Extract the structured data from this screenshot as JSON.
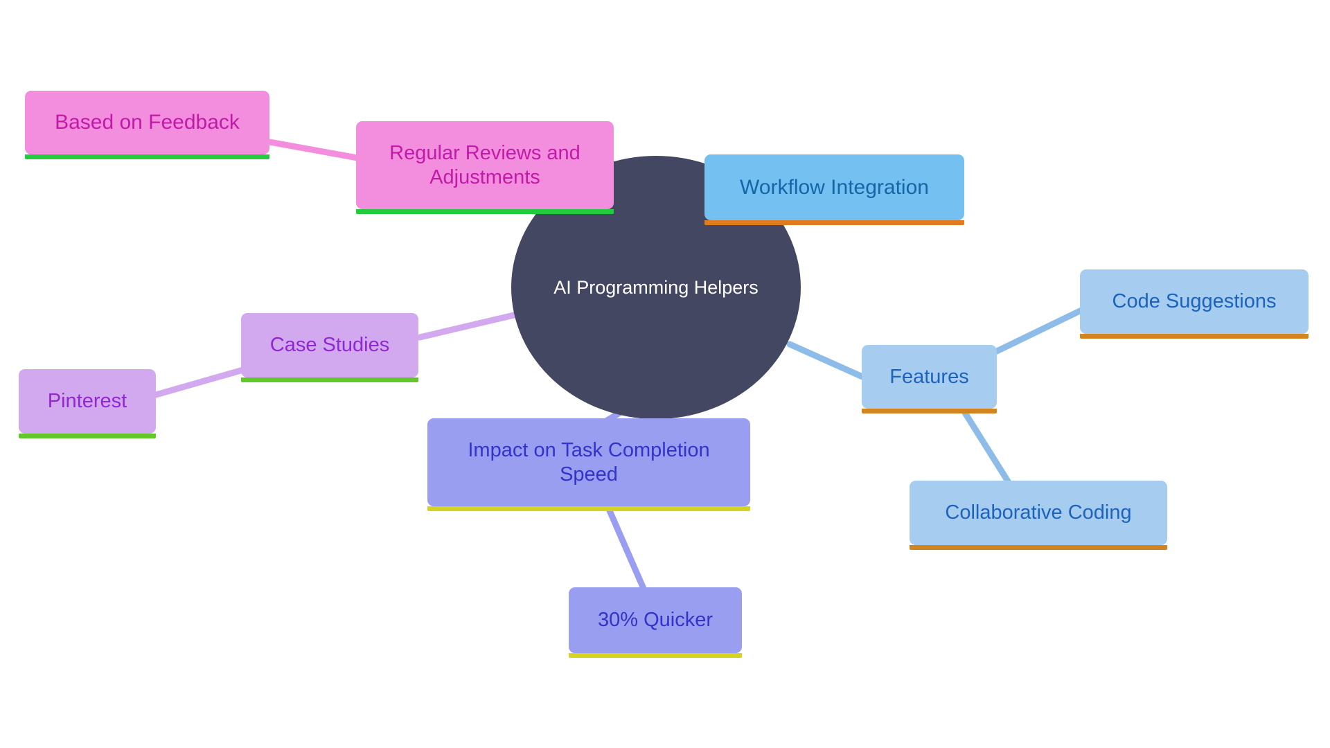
{
  "diagram": {
    "type": "mindmap",
    "title": "AI Programming Helpers",
    "background": "#ffffff"
  },
  "root": {
    "label": "AI Programming Helpers",
    "fill": "#434761",
    "text_color": "#ffffff",
    "shape": "ellipse"
  },
  "branches": [
    {
      "id": "workflow-integration",
      "label": "Workflow Integration",
      "fill": "#74c0f0",
      "text_color": "#1565a8",
      "accent": "#e07b20",
      "edge_color": "#74c0f0"
    },
    {
      "id": "features",
      "label": "Features",
      "fill": "#a6cdf0",
      "text_color": "#1d63bb",
      "accent": "#d4841f",
      "edge_color": "#8dbce8"
    },
    {
      "id": "code-suggestions",
      "label": "Code Suggestions",
      "fill": "#a6cdf0",
      "text_color": "#1d63bb",
      "accent": "#d4841f",
      "edge_color": "#8dbce8"
    },
    {
      "id": "collaborative-coding",
      "label": "Collaborative Coding",
      "fill": "#a6cdf0",
      "text_color": "#1d63bb",
      "accent": "#d4841f",
      "edge_color": "#8dbce8"
    },
    {
      "id": "impact-on-task-completion-speed",
      "label": "Impact on Task Completion\nSpeed",
      "fill": "#9a9ef0",
      "text_color": "#3333cc",
      "accent": "#d6d321",
      "edge_color": "#9a9ef0"
    },
    {
      "id": "thirty-percent-quicker",
      "label": "30% Quicker",
      "fill": "#9a9ef0",
      "text_color": "#3333cc",
      "accent": "#d6d321",
      "edge_color": "#9a9ef0"
    },
    {
      "id": "case-studies",
      "label": "Case Studies",
      "fill": "#d2a8ee",
      "text_color": "#9127d4",
      "accent": "#63c72b",
      "edge_color": "#d2a8ee"
    },
    {
      "id": "pinterest",
      "label": "Pinterest",
      "fill": "#d2a8ee",
      "text_color": "#9127d4",
      "accent": "#63c72b",
      "edge_color": "#d2a8ee"
    },
    {
      "id": "regular-reviews-and-adjustments",
      "label": "Regular Reviews and\nAdjustments",
      "fill": "#f38ede",
      "text_color": "#c21aa8",
      "accent": "#22cc3b",
      "edge_color": "#f38ede"
    },
    {
      "id": "based-on-feedback",
      "label": "Based on Feedback",
      "fill": "#f38ede",
      "text_color": "#c21aa8",
      "accent": "#22cc3b",
      "edge_color": "#f38ede"
    }
  ],
  "connections": [
    {
      "from": "AI Programming Helpers",
      "to": "Workflow Integration"
    },
    {
      "from": "AI Programming Helpers",
      "to": "Features"
    },
    {
      "from": "Features",
      "to": "Code Suggestions"
    },
    {
      "from": "Features",
      "to": "Collaborative Coding"
    },
    {
      "from": "AI Programming Helpers",
      "to": "Impact on Task Completion Speed"
    },
    {
      "from": "Impact on Task Completion Speed",
      "to": "30% Quicker"
    },
    {
      "from": "AI Programming Helpers",
      "to": "Case Studies"
    },
    {
      "from": "Case Studies",
      "to": "Pinterest"
    },
    {
      "from": "AI Programming Helpers",
      "to": "Regular Reviews and Adjustments"
    },
    {
      "from": "Regular Reviews and Adjustments",
      "to": "Based on Feedback"
    }
  ]
}
